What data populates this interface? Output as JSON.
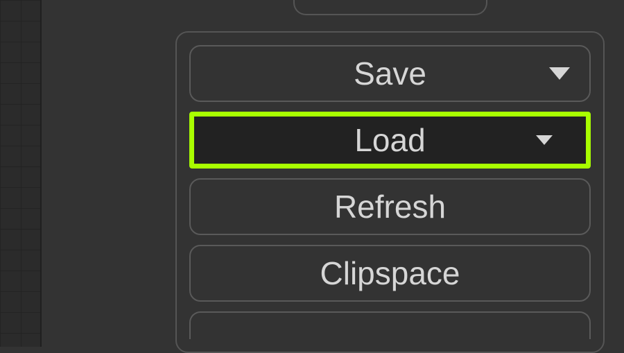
{
  "panel": {
    "buttons": {
      "save": {
        "label": "Save",
        "has_dropdown": true
      },
      "load": {
        "label": "Load",
        "has_dropdown": true,
        "highlighted": true
      },
      "refresh": {
        "label": "Refresh",
        "has_dropdown": false
      },
      "clipspace": {
        "label": "Clipspace",
        "has_dropdown": false
      }
    }
  },
  "colors": {
    "highlight": "#a8ff00",
    "background": "#333333",
    "text": "#d6d6d6",
    "border": "#5a5a5a"
  }
}
